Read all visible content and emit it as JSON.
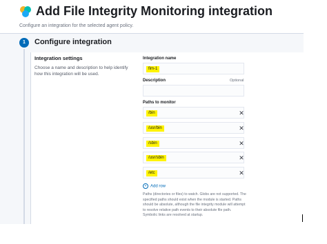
{
  "header": {
    "title": "Add File Integrity Monitoring integration",
    "subtitle": "Configure an integration for the selected agent policy."
  },
  "step": {
    "number": "1",
    "title": "Configure integration"
  },
  "settings": {
    "title": "Integration settings",
    "description": "Choose a name and description to help identify how this integration will be used."
  },
  "form": {
    "name_label": "Integration name",
    "name_value": "fim-1",
    "description_label": "Description",
    "optional_label": "Optional",
    "description_value": "",
    "paths_label": "Paths to monitor",
    "paths": [
      "/bin",
      "/usr/bin",
      "/sbin",
      "/usr/sbin",
      "/etc"
    ],
    "add_row_label": "Add row",
    "help_text": "Paths (directories or files) to watch. Globs are not supported. The specified paths should exist when the module is started. Paths should be absolute, although the file integrity module will attempt to resolve relative path events to their absolute file path. Symbolic links are resolved at startup."
  },
  "colors": {
    "accent": "#006bb8",
    "highlight": "#fff300"
  }
}
